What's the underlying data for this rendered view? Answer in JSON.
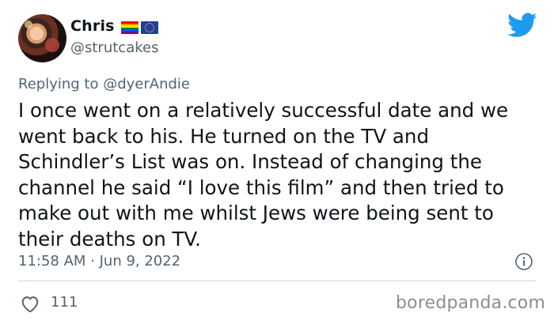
{
  "author": {
    "display_name": "Chris",
    "handle": "@strutcakes",
    "flags": [
      "rainbow-pride-flag",
      "eu-flag"
    ]
  },
  "reply": {
    "prefix": "Replying to",
    "mention": "@dyerAndie"
  },
  "tweet": {
    "text": "I once went on a relatively successful date and we\nwent back to his. He turned on the TV and\nSchindler’s List was on. Instead of changing the\nchannel he said “I love this film” and then tried to\nmake out with me whilst Jews were being sent to\ntheir deaths on TV.",
    "timestamp": "11:58 AM · Jun 9, 2022"
  },
  "engagement": {
    "likes": "111"
  },
  "watermark": "boredpanda.com",
  "colors": {
    "twitter_blue": "#1d9bf0",
    "secondary_text": "#536471",
    "primary_text": "#0f1419"
  }
}
